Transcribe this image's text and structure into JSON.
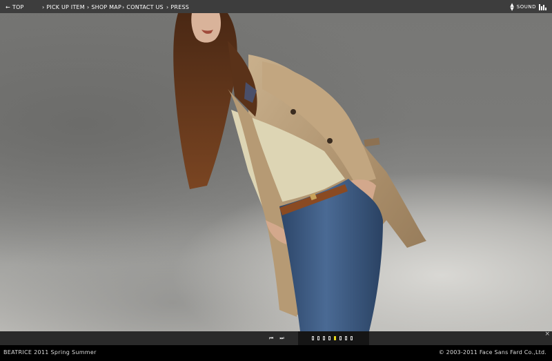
{
  "topbar": {
    "sound": {
      "label": "SOUND",
      "icon": "sound-eq-icon",
      "toggle_icon": "updown-arrows-icon"
    }
  },
  "hero": {
    "image": "model-in-trench-coat-photo",
    "colors": {
      "coat": "#b89d7a",
      "jeans": "#34517a",
      "belt": "#8a4a22",
      "hair": "#6a3a1c",
      "sky": "#7c7c7a"
    }
  },
  "nav": {
    "items": [
      {
        "label": "TOP",
        "icon": "arrow-left-icon",
        "prefix": "←"
      },
      {
        "label": "PICK UP ITEM",
        "icon": "chevron-right-icon",
        "prefix": "›"
      },
      {
        "label": "SHOP MAP",
        "icon": "chevron-right-icon",
        "prefix": "›"
      },
      {
        "label": "CONTACT US",
        "icon": "chevron-right-icon",
        "prefix": "›"
      },
      {
        "label": "PRESS",
        "icon": "chevron-right-icon",
        "prefix": "›"
      }
    ],
    "player": {
      "prev": "⏮",
      "next": "⏭"
    },
    "slides": {
      "count": 8,
      "active": 5,
      "active_color": "#e8d81c"
    },
    "close": "×"
  },
  "footer": {
    "brand": "BEATRICE 2011 Spring Summer",
    "copyright": "© 2003-2011 Face Sans Fard Co.,Ltd."
  }
}
